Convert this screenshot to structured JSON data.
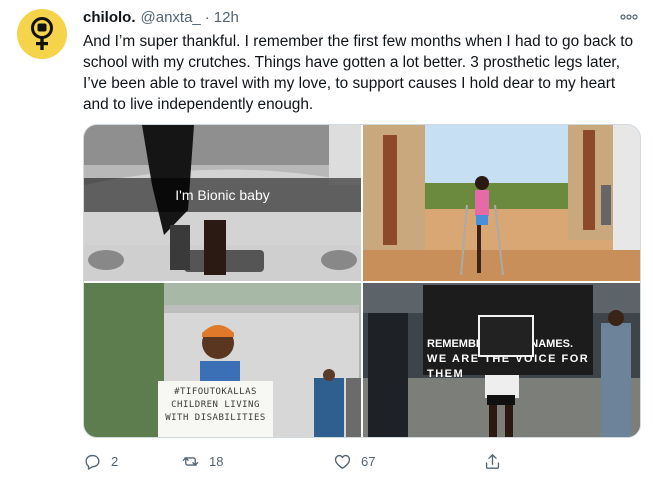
{
  "tweet": {
    "display_name": "chilolo.",
    "handle": "@anxta_",
    "separator": "·",
    "time": "12h",
    "more_icon": "more-horizontal-icon",
    "avatar_icon": "female-symbol-fist-icon",
    "text": "And I’m super thankful. I remember the first few months when I had to go back to school with my crutches. Things have gotten a lot better. 3 prosthetic legs later, I’ve been able to travel with my love, to support causes I hold dear to my heart and to live independently enough."
  },
  "media": {
    "photo1": {
      "caption": "I'm Bionic baby"
    },
    "photo2": {},
    "photo3": {
      "sign_text": "#TIFOUTOKALLAS CHILDREN LIVING WITH DISABILITIES"
    },
    "photo4": {
      "banner_line1": "REMEMBER THEIR NAMES.",
      "banner_line2": "WE ARE THE VOICE FOR THEM"
    }
  },
  "actions": {
    "reply": {
      "icon": "reply-icon",
      "count": "2"
    },
    "retweet": {
      "icon": "retweet-icon",
      "count": "18"
    },
    "like": {
      "icon": "heart-icon",
      "count": "67"
    },
    "share": {
      "icon": "share-icon"
    }
  },
  "colors": {
    "avatar_bg": "#f5d34a",
    "secondary_text": "#536471",
    "primary_text": "#0f1419"
  }
}
